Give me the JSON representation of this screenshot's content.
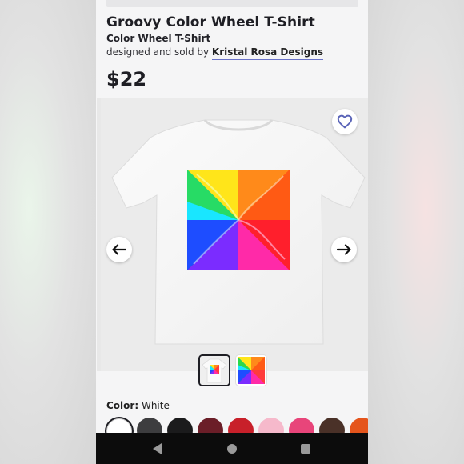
{
  "product": {
    "title": "Groovy Color Wheel T-Shirt",
    "subtitle": "Color Wheel T-Shirt",
    "byline_prefix": "designed and sold by",
    "designer": "Kristal Rosa Designs",
    "price": "$22"
  },
  "gallery": {
    "favorite_icon": "heart-outline-icon",
    "prev_icon": "arrow-left-icon",
    "next_icon": "arrow-right-icon",
    "thumbnails": [
      "tshirt-thumbnail",
      "design-thumbnail"
    ],
    "selected_thumbnail": 0
  },
  "color": {
    "label": "Color:",
    "selected": "White",
    "swatches": [
      "#ffffff",
      "#3d3d3f",
      "#1b1b1c",
      "#6b1e28",
      "#c8202a",
      "#f6b9cb",
      "#e8457a",
      "#4a3128",
      "#e5551c"
    ]
  },
  "colors": {
    "designer_underline": "#6a72c8",
    "heart": "#5a64b8",
    "text": "#1e1e24"
  },
  "system_nav": {
    "back_icon": "triangle-back-icon",
    "home_icon": "circle-home-icon",
    "recents_icon": "square-recents-icon"
  }
}
